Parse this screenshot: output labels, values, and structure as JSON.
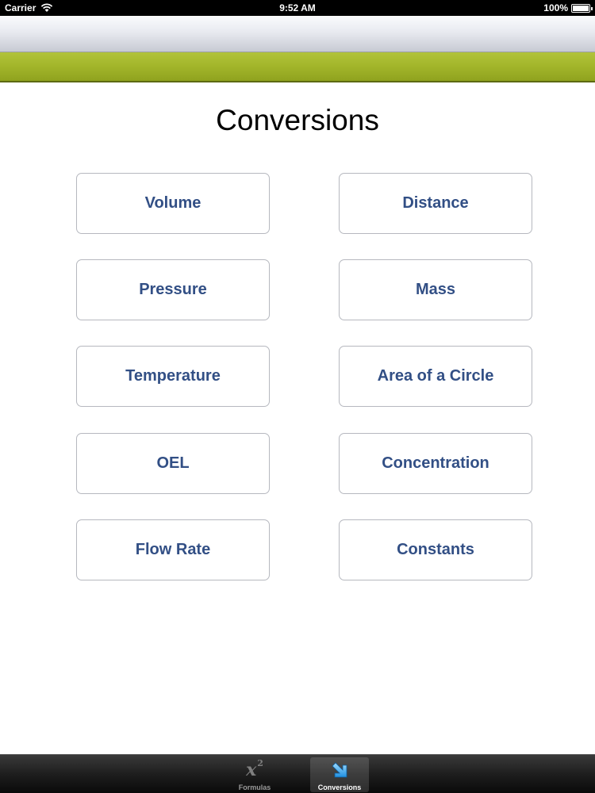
{
  "status_bar": {
    "carrier": "Carrier",
    "time": "9:52 AM",
    "battery": "100%",
    "icons": [
      "wifi-icon",
      "battery-icon"
    ]
  },
  "header": {
    "accent_color": "#a2b52a"
  },
  "main": {
    "title": "Conversions",
    "button_text_color": "#324f85",
    "buttons": [
      {
        "label": "Volume"
      },
      {
        "label": "Distance"
      },
      {
        "label": "Pressure"
      },
      {
        "label": "Mass"
      },
      {
        "label": "Temperature"
      },
      {
        "label": "Area of a Circle"
      },
      {
        "label": "OEL"
      },
      {
        "label": "Concentration"
      },
      {
        "label": "Flow Rate"
      },
      {
        "label": "Constants"
      }
    ]
  },
  "tab_bar": {
    "selected": "Conversions",
    "tabs": [
      {
        "label": "Formulas",
        "icon": "x-squared-icon",
        "icon_text": "x",
        "icon_sup": "2"
      },
      {
        "label": "Conversions",
        "icon": "arrow-icon"
      }
    ]
  }
}
